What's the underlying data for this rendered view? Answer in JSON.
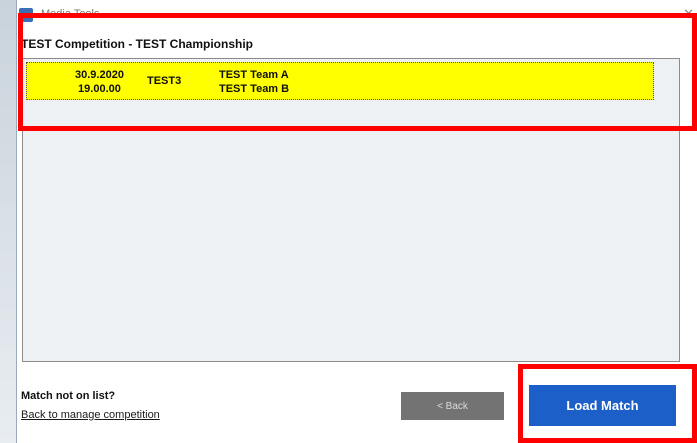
{
  "window": {
    "title": "Media Tools",
    "close_glyph": "✕"
  },
  "heading": "TEST Competition - TEST Championship",
  "matches": [
    {
      "date": "30.9.2020",
      "time": "19.00.00",
      "code": "TEST3",
      "team_a": "TEST Team A",
      "team_b": "TEST Team B",
      "highlight_color": "#ffff00"
    }
  ],
  "footer": {
    "not_on_list": "Match not on list?",
    "back_link": "Back to manage competition"
  },
  "buttons": {
    "back_label": "< Back",
    "load_label": "Load Match"
  },
  "colors": {
    "accent": "#1d5fc9",
    "annotation": "#ff0000"
  }
}
